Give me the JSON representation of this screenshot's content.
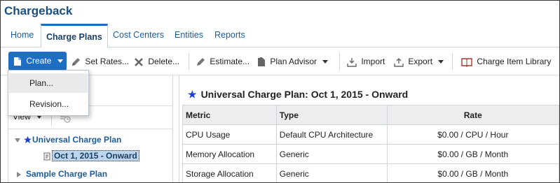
{
  "app": {
    "title": "Chargeback"
  },
  "tabs": [
    {
      "label": "Home",
      "active": false
    },
    {
      "label": "Charge Plans",
      "active": true
    },
    {
      "label": "Cost Centers",
      "active": false
    },
    {
      "label": "Entities",
      "active": false
    },
    {
      "label": "Reports",
      "active": false
    }
  ],
  "toolbar": {
    "create": "Create",
    "set_rates": "Set Rates...",
    "delete": "Delete...",
    "estimate": "Estimate...",
    "plan_advisor": "Plan Advisor",
    "import": "Import",
    "export": "Export",
    "charge_item_library": "Charge Item Library"
  },
  "create_menu": {
    "items": [
      "Plan...",
      "Revision..."
    ]
  },
  "left_panel": {
    "view_label": "View",
    "tree": {
      "root": "Universal Charge Plan",
      "child": "Oct 1, 2015 - Onward",
      "sibling": "Sample Charge Plan"
    }
  },
  "plan": {
    "title": "Universal Charge Plan: Oct 1, 2015 - Onward",
    "columns": [
      "Metric",
      "Type",
      "Rate"
    ],
    "rows": [
      {
        "metric": "CPU Usage",
        "type": "Default CPU Architecture",
        "rate": "$0.00 / CPU / Hour"
      },
      {
        "metric": "Memory Allocation",
        "type": "Generic",
        "rate": "$0.00 / GB / Month"
      },
      {
        "metric": "Storage Allocation",
        "type": "Generic",
        "rate": "$0.00 / GB / Month"
      }
    ]
  },
  "colors": {
    "brand": "#1b4f80",
    "accent": "#1e6ec4",
    "link": "#1d5b9c",
    "star": "#1d3fcf"
  },
  "icons": [
    "document-icon",
    "pencil-icon",
    "delete-x-icon",
    "plan-advisor-icon",
    "import-icon",
    "export-icon",
    "book-icon",
    "star-icon",
    "history-icon",
    "plan-revision-icon"
  ]
}
